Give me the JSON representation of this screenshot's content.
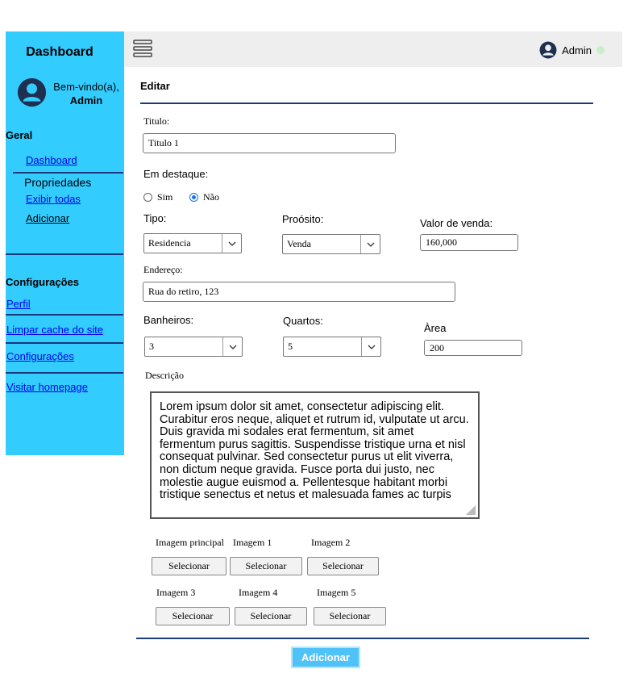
{
  "sidebar": {
    "title": "Dashboard",
    "welcome": "Bem-vindo(a),",
    "user": "Admin",
    "section_geral": "Geral",
    "link_dashboard": "Dashboard",
    "propriedades": "Propriedades",
    "link_exibir": "Exibir todas",
    "link_adicionar": "Adicionar",
    "section_config": "Configurações",
    "link_perfil": "Perfil",
    "link_limpar": "Limpar cache do site",
    "link_config": "Configurações",
    "link_visitar": "Visitar homepage"
  },
  "topbar": {
    "user": "Admin"
  },
  "form": {
    "heading": "Editar",
    "titulo_label": "Titulo:",
    "titulo_value": "Titulo 1",
    "destaque_label": "Em destaque:",
    "radio_sim": "Sim",
    "radio_nao": "Não",
    "destaque_selected": "Não",
    "tipo_label": "Tipo:",
    "tipo_value": "Residencia",
    "proposito_label": "Proósito:",
    "proposito_value": "Venda",
    "valor_label": "Valor de venda:",
    "valor_value": "160,000",
    "endereco_label": "Endereço:",
    "endereco_value": "Rua do retiro, 123",
    "banheiros_label": "Banheiros:",
    "banheiros_value": "3",
    "quartos_label": "Quartos:",
    "quartos_value": "5",
    "area_label": "Àrea",
    "area_value": "200",
    "descricao_label": "Descrição",
    "descricao_value": "Lorem ipsum dolor sit amet, consectetur adipiscing elit. Curabitur eros neque, aliquet et rutrum id, vulputate ut arcu. Duis gravida mi sodales erat fermentum, sit amet fermentum purus sagittis. Suspendisse tristique urna et nisl consequat pulvinar. Sed consectetur purus ut elit viverra, non dictum neque gravida. Fusce porta dui justo, nec molestie augue euismod a. Pellentesque habitant morbi tristique senectus et netus et malesuada fames ac turpis",
    "images": [
      {
        "label": "Imagem principal",
        "button": "Selecionar"
      },
      {
        "label": "Imagem 1",
        "button": "Selecionar"
      },
      {
        "label": "Imagem 2",
        "button": "Selecionar"
      },
      {
        "label": "Imagem 3",
        "button": "Selecionar"
      },
      {
        "label": "Imagem 4",
        "button": "Selecionar"
      },
      {
        "label": "Imagem 5",
        "button": "Selecionar"
      }
    ],
    "submit": "Adicionar"
  },
  "colors": {
    "sidebar_bg": "#33ccff",
    "topbar_bg": "#eeeeee",
    "divider": "#1a3a7a",
    "submit_bg": "#4fc3f7",
    "online_dot": "#c8efc8"
  },
  "icons": {
    "avatar": "user-circle-icon",
    "menu": "hamburger-icon",
    "select_arrow": "chevron-down-icon"
  }
}
